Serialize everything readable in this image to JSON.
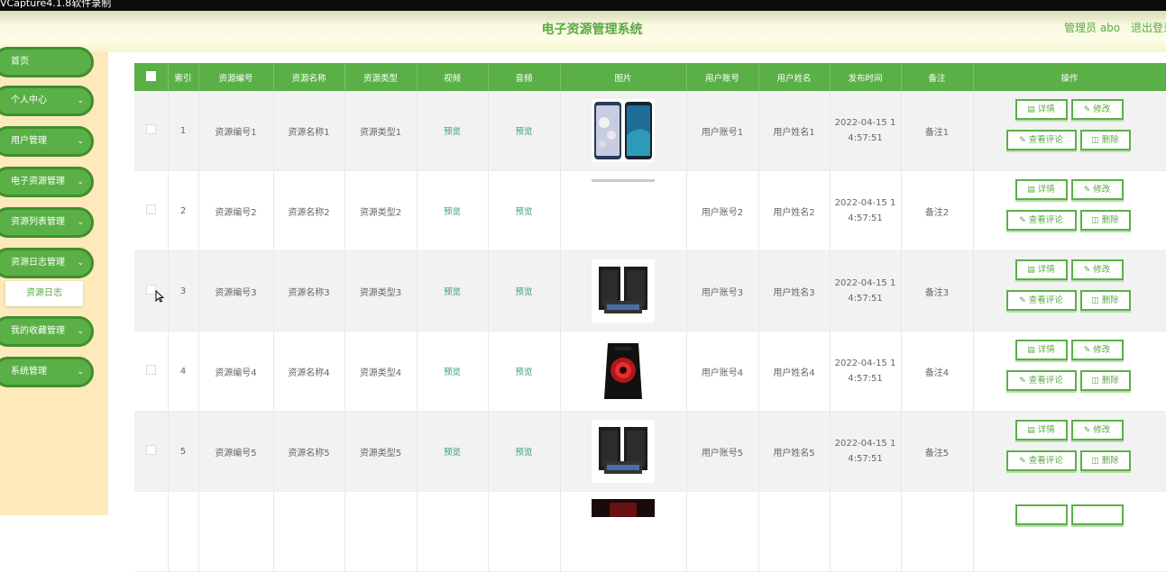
{
  "capture_title": "VCapture4.1.8软件录制",
  "header": {
    "title": "电子资源管理系统",
    "admin_label": "管理员 abo",
    "logout_label": "退出登录"
  },
  "sidebar": {
    "items": [
      {
        "label": "首页"
      },
      {
        "label": "个人中心"
      },
      {
        "label": "用户管理"
      },
      {
        "label": "电子资源管理"
      },
      {
        "label": "资源列表管理"
      },
      {
        "label": "资源日志管理"
      },
      {
        "label": "我的收藏管理"
      },
      {
        "label": "系统管理"
      }
    ],
    "subitem": "资源日志"
  },
  "table": {
    "headers": [
      "索引",
      "资源编号",
      "资源名称",
      "资源类型",
      "视频",
      "音频",
      "图片",
      "用户账号",
      "用户姓名",
      "发布时间",
      "备注",
      "操作"
    ],
    "preview_label": "预览",
    "actions": {
      "detail": "详情",
      "edit": "修改",
      "comment": "查看评论",
      "delete": "删除"
    },
    "rows": [
      {
        "index": "1",
        "code": "资源编号1",
        "name": "资源名称1",
        "type": "资源类型1",
        "image_icon": "phone-image",
        "account": "用户账号1",
        "username": "用户姓名1",
        "time1": "2022-04-15 1",
        "time2": "4:57:51",
        "note": "备注1"
      },
      {
        "index": "2",
        "code": "资源编号2",
        "name": "资源名称2",
        "type": "资源类型2",
        "image_icon": "blank-image",
        "account": "用户账号2",
        "username": "用户姓名2",
        "time1": "2022-04-15 1",
        "time2": "4:57:51",
        "note": "备注2"
      },
      {
        "index": "3",
        "code": "资源编号3",
        "name": "资源名称3",
        "type": "资源类型3",
        "image_icon": "speaker-image",
        "account": "用户账号3",
        "username": "用户姓名3",
        "time1": "2022-04-15 1",
        "time2": "4:57:51",
        "note": "备注3"
      },
      {
        "index": "4",
        "code": "资源编号4",
        "name": "资源名称4",
        "type": "资源类型4",
        "image_icon": "pc-case-image",
        "account": "用户账号4",
        "username": "用户姓名4",
        "time1": "2022-04-15 1",
        "time2": "4:57:51",
        "note": "备注4"
      },
      {
        "index": "5",
        "code": "资源编号5",
        "name": "资源名称5",
        "type": "资源类型5",
        "image_icon": "speaker-image",
        "account": "用户账号5",
        "username": "用户姓名5",
        "time1": "2022-04-15 1",
        "time2": "4:57:51",
        "note": "备注5"
      }
    ]
  },
  "colors": {
    "primary": "#5ab046",
    "sidebar_bg": "#fde9b9",
    "link": "#3aa06c"
  }
}
